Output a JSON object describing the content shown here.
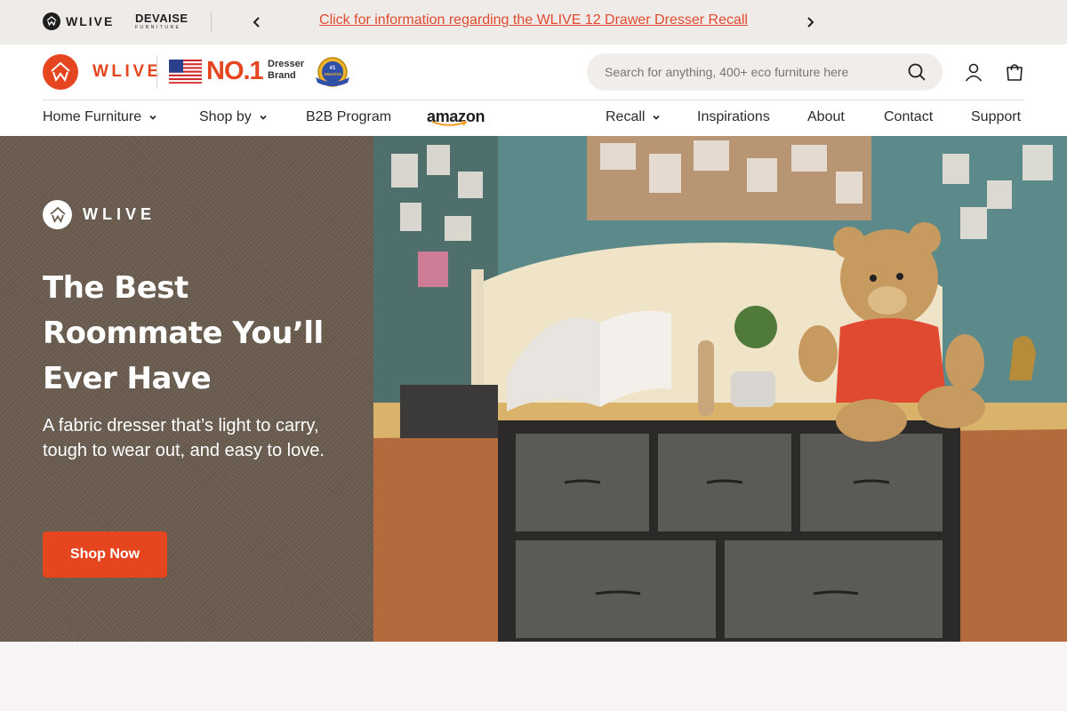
{
  "topbar": {
    "brand_wlive": "WLIVE",
    "brand_devaise": "DEVAISE",
    "brand_devaise_sub": "FURNITURE",
    "announcement": "Click for information regarding the WLIVE 12 Drawer Dresser Recall",
    "announcement_color": "#e14a2e",
    "prev_icon": "chevron-left-icon",
    "next_icon": "chevron-right-icon"
  },
  "header": {
    "logo_text": "WLIVE",
    "no1_text": "NO.1",
    "dresser_brand_line1": "Dresser",
    "dresser_brand_line2": "Brand",
    "badge_top": "#1",
    "badge_text": "AMAZON",
    "search_placeholder": "Search for anything, 400+ eco furniture here",
    "icons": [
      "search-icon",
      "account-icon",
      "cart-icon"
    ],
    "accent_color": "#e5451f"
  },
  "nav": {
    "left": [
      {
        "label": "Home Furniture",
        "dropdown": true
      },
      {
        "label": "Shop by",
        "dropdown": true
      },
      {
        "label": "B2B Program",
        "dropdown": false
      }
    ],
    "amazon_label": "amazon",
    "right": [
      {
        "label": "Recall",
        "dropdown": true
      },
      {
        "label": "Inspirations",
        "dropdown": false
      },
      {
        "label": "About",
        "dropdown": false
      },
      {
        "label": "Contact",
        "dropdown": false
      },
      {
        "label": "Support",
        "dropdown": false
      }
    ]
  },
  "hero": {
    "logo_text": "WLIVE",
    "title": "The Best Roommate You’ll Ever Have",
    "subtitle": "A fabric dresser that’s light to carry, tough to wear out, and easy to love.",
    "cta_label": "Shop Now",
    "cta_color": "#e5451f"
  }
}
